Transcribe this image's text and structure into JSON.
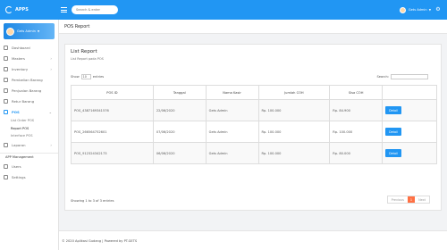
{
  "topbar": {
    "app_name": "APPS",
    "search_placeholder": "Search & enter",
    "user_name": "Gets Admin"
  },
  "sidebar": {
    "profile_name": "Gets Admin",
    "items": [
      {
        "label": "Dashboard"
      },
      {
        "label": "Masters"
      },
      {
        "label": "Inventory"
      },
      {
        "label": "Pembelian Barang"
      },
      {
        "label": "Penjualan Barang"
      },
      {
        "label": "Retur Barang"
      },
      {
        "label": "POS"
      }
    ],
    "pos_sub": [
      {
        "label": "List Order POS"
      },
      {
        "label": "Report POS"
      },
      {
        "label": "Interface POS"
      }
    ],
    "laporan": "Laporan",
    "section_title": "APP Management",
    "mgmt": [
      {
        "label": "Users"
      },
      {
        "label": "Settings"
      }
    ]
  },
  "page": {
    "title": "POS Report"
  },
  "card": {
    "title": "List Report",
    "subtitle": "List Report pada POS",
    "show_label": "Show",
    "show_value": "10",
    "entries_label": "entries",
    "search_label": "Search:",
    "info": "Showing 1 to 3 of 3 entries",
    "prev": "Previous",
    "page": "1",
    "next": "Next"
  },
  "table": {
    "headers": [
      "POS ID",
      "Tanggal",
      "Nama Kasir",
      "Jumlah COH",
      "Sisa COH"
    ],
    "rows": [
      {
        "pos_id": "POS_4387169341576",
        "tanggal": "22/06/2020",
        "kasir": "Gets Admin",
        "jumlah": "Rp. 100.000",
        "sisa": "Rp. 84.900",
        "action": "Detail"
      },
      {
        "pos_id": "POS_266564752601",
        "tanggal": "07/06/2020",
        "kasir": "Gets Admin",
        "jumlah": "Rp. 100.000",
        "sisa": "Rp. 100.000",
        "action": "Detail"
      },
      {
        "pos_id": "POS_912324342173",
        "tanggal": "06/06/2020",
        "kasir": "Gets Admin",
        "jumlah": "Rp. 100.000",
        "sisa": "Rp. 80.000",
        "action": "Detail"
      }
    ]
  },
  "footer": {
    "text": "© 2020 Aplikasi Gudang | Powered by PT.GETS"
  },
  "colors": {
    "primary": "#2196f3",
    "pager_active": "#ff7043"
  }
}
